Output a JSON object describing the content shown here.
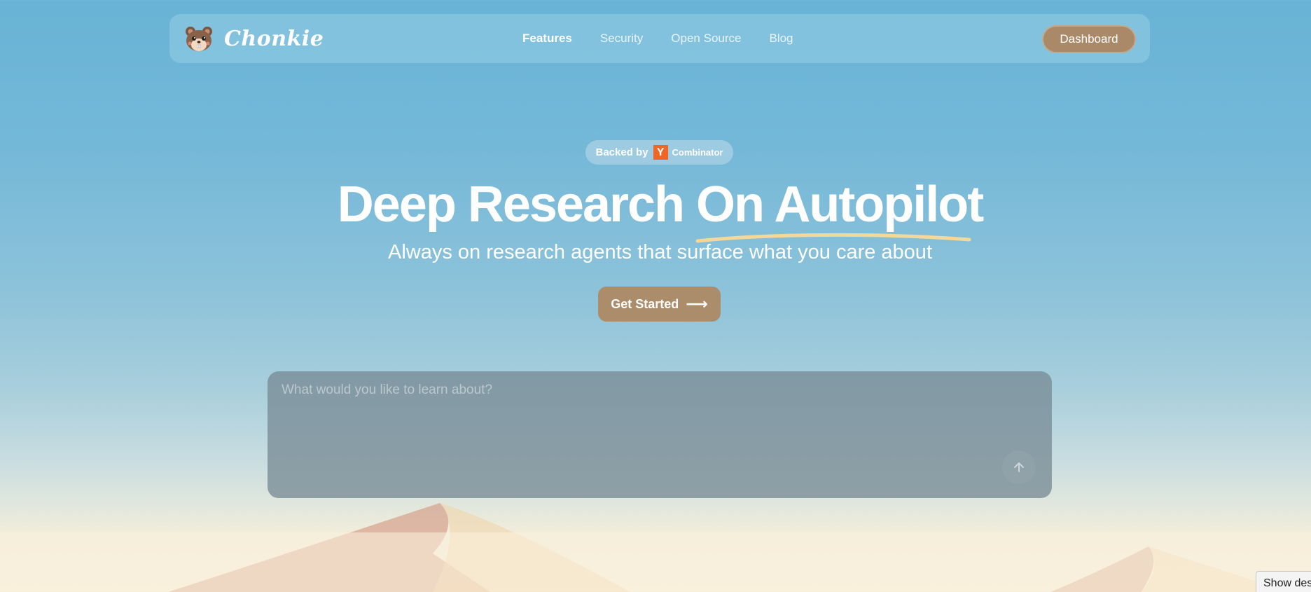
{
  "brand": {
    "name": "Chonkie",
    "logo_icon": "hamster-logo-icon"
  },
  "nav": {
    "links": [
      {
        "label": "Features",
        "active": true
      },
      {
        "label": "Security",
        "active": false
      },
      {
        "label": "Open Source",
        "active": false
      },
      {
        "label": "Blog",
        "active": false
      }
    ],
    "dashboard_label": "Dashboard"
  },
  "hero": {
    "badge": {
      "prefix": "Backed by",
      "logo_letter": "Y",
      "suffix": "Combinator",
      "logo_color": "#f26522"
    },
    "headline": "Deep Research On Autopilot",
    "subheadline": "Always on research agents that surface what you care about",
    "cta_label": "Get Started",
    "cta_icon": "arrow-right-icon"
  },
  "prompt": {
    "placeholder": "What would you like to learn about?",
    "send_icon": "arrow-up-icon"
  },
  "toast": {
    "label": "Show desk"
  },
  "colors": {
    "accent_brown": "#ac8d6b",
    "underline_gold": "#f3d89a",
    "sky_top": "#68b3d6",
    "sand": "#f9f1dc"
  }
}
